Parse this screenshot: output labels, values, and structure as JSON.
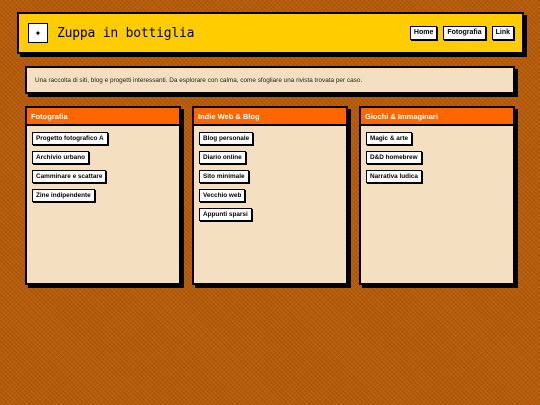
{
  "header": {
    "logo_glyph": "✦",
    "title": "Zuppa in bottiglia",
    "nav": [
      "Home",
      "Fotografia",
      "Link"
    ]
  },
  "intro": {
    "text": "Una raccolta di siti, blog e progetti interessanti. Da esplorare con calma, come sfogliare una rivista trovata per caso."
  },
  "sections": [
    {
      "title": "Fotografia",
      "links": [
        "Progetto fotografico A",
        "Archivio urbano",
        "Camminare e scattare",
        "Zine indipendente"
      ]
    },
    {
      "title": "Indie Web & Blog",
      "links": [
        "Blog personale",
        "Diario online",
        "Sito minimale",
        "Vecchio web",
        "Appunti sparsi"
      ]
    },
    {
      "title": "Giochi & Immaginari",
      "links": [
        "Magic & arte",
        "D&D homebrew",
        "Narrativa ludica"
      ]
    }
  ],
  "colors": {
    "background": "#b85c0a",
    "header": "#ffcc00",
    "card_head": "#ff6600",
    "card_body": "#f4e0c0"
  }
}
